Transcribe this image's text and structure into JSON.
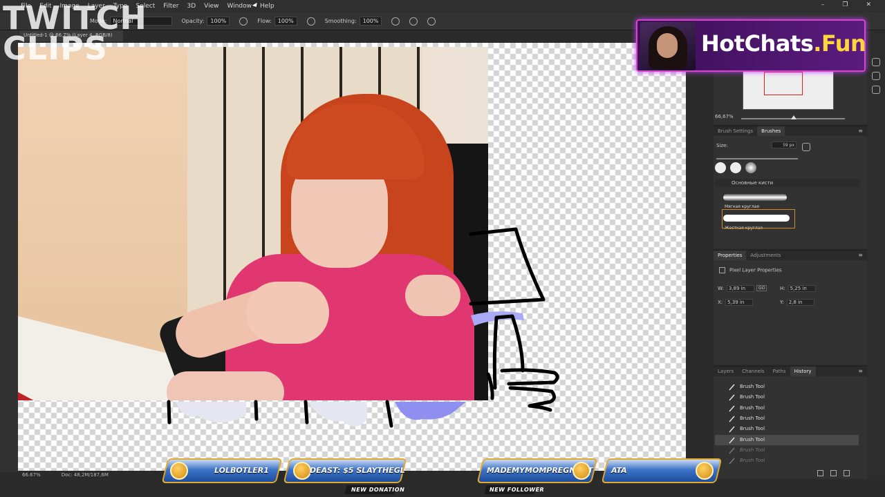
{
  "menubar": {
    "items": [
      "File",
      "Edit",
      "Image",
      "Layer",
      "Type",
      "Select",
      "Filter",
      "3D",
      "View",
      "Window",
      "Help"
    ]
  },
  "options": {
    "mode_label": "Mode:",
    "mode_value": "Normal",
    "opacity_label": "Opacity:",
    "opacity_value": "100%",
    "flow_label": "Flow:",
    "flow_value": "100%",
    "smoothing_label": "Smoothing:",
    "smoothing_value": "100%"
  },
  "document": {
    "tab_label": "Untitled-1 @ 66,7% (Layer 4, RGB/8)"
  },
  "status": {
    "zoom": "66.67%",
    "doc": "Doc: 48,2M/187,6M"
  },
  "navigator": {
    "zoom": "66,67%"
  },
  "brushes_panel": {
    "tabs": [
      "Brush Settings",
      "Brushes"
    ],
    "active_tab": "Brushes",
    "size_label": "Size:",
    "size_value": "59 px",
    "group_name": "Основные кисти",
    "brush_1": "Мягкая круглая",
    "brush_2": "Жесткая круглая"
  },
  "properties_panel": {
    "tabs": [
      "Properties",
      "Adjustments"
    ],
    "title": "Pixel Layer Properties",
    "w_label": "W:",
    "w_value": "3,89 in",
    "h_label": "H:",
    "h_value": "5,25 in",
    "x_label": "X:",
    "x_value": "5,39 in",
    "y_label": "Y:",
    "y_value": "2,8 in",
    "link_label": "GO"
  },
  "history_panel": {
    "tabs": [
      "Layers",
      "Channels",
      "Paths",
      "History"
    ],
    "active_tab": "History",
    "items": [
      {
        "label": "Brush Tool",
        "state": "normal"
      },
      {
        "label": "Brush Tool",
        "state": "normal"
      },
      {
        "label": "Brush Tool",
        "state": "normal"
      },
      {
        "label": "Brush Tool",
        "state": "normal"
      },
      {
        "label": "Brush Tool",
        "state": "normal"
      },
      {
        "label": "Brush Tool",
        "state": "active"
      },
      {
        "label": "Brush Tool",
        "state": "dim"
      },
      {
        "label": "Brush Tool",
        "state": "dim"
      }
    ]
  },
  "watermark": {
    "line1": "TWITCH",
    "line2": "CLIPS"
  },
  "ad": {
    "brand_main": "HotChats",
    "brand_accent": ".Fun",
    "accent_color": "#ffd53d"
  },
  "alerts": {
    "donor": "LOLBOTLER1",
    "donation": "DEAST: $5   SLAYTHEGL",
    "follower": "MADEMYMOMPREGNANT",
    "extra": "ATA",
    "caption_donation": "NEW DONATION",
    "caption_follower": "NEW FOLLOWER"
  }
}
